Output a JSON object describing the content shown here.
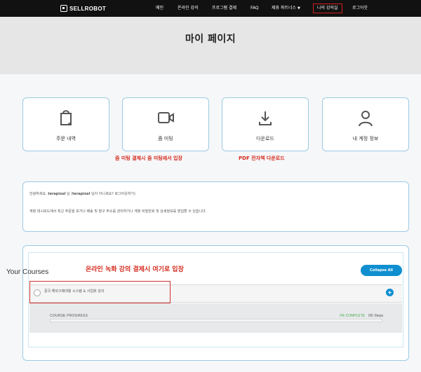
{
  "app": {
    "logo_text": "SELLROBOT"
  },
  "nav": {
    "items": [
      {
        "label": "메인"
      },
      {
        "label": "온라인 강의"
      },
      {
        "label": "프로그램 결제"
      },
      {
        "label": "FAQ"
      },
      {
        "label": "제휴 파트너스"
      },
      {
        "label": "나의 강의실"
      },
      {
        "label": "로그아웃"
      }
    ],
    "active_index": 5
  },
  "page": {
    "title": "마이 페이지"
  },
  "cards": [
    {
      "label": "주문 내역",
      "icon": "shopping-bag-icon"
    },
    {
      "label": "줌 미팅",
      "icon": "video-camera-icon"
    },
    {
      "label": "다운로드",
      "icon": "download-icon"
    },
    {
      "label": "내 계정 정보",
      "icon": "user-icon"
    }
  ],
  "annotations": {
    "zoom": "줌 미팅 결제시 줌 미팅에서 입장",
    "pdf": "PDF 전자책 다운로드",
    "courses": "온라인 녹화 강의 결제시 여기로 입장"
  },
  "welcome": {
    "line1_prefix": "안녕하세요,",
    "user": "terapixel",
    "line1_middle": "님 (",
    "user2": "terapixel",
    "line1_suffix": "님이 아니세요? 로그아웃하기)",
    "line2": "계정 대시보드에서 최근 주문을 보거나 배송 및 청구 주소를 관리하거나 계정 비밀번호 및 상세정보를 편집할 수 있습니다."
  },
  "courses": {
    "title": "Your Courses",
    "collapse_label": "Collapse All",
    "items": [
      {
        "name": "중국 해외구매대행 시스템 & 사업화 강의",
        "progress_label": "COURSE PROGRESS",
        "progress_text": "0% COMPLETE",
        "days_text": "0/0 Steps",
        "progress": 0
      }
    ]
  }
}
